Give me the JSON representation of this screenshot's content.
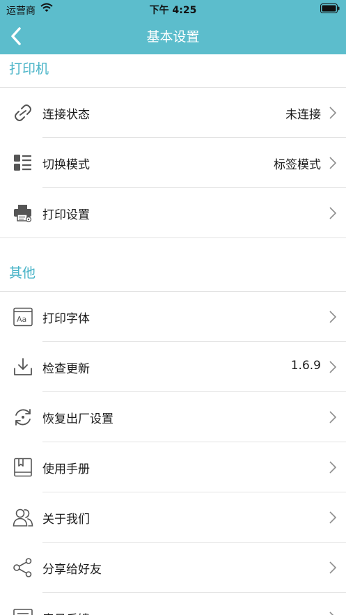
{
  "status_bar": {
    "carrier": "运营商",
    "time": "下午 4:25"
  },
  "nav": {
    "title": "基本设置",
    "back_icon": "chevron-left-icon"
  },
  "colors": {
    "header_bg": "#5cbdcc",
    "section_accent": "#47b3c7",
    "icon_stroke": "#555555",
    "chevron": "#8e8e8e"
  },
  "sections": {
    "printer": {
      "title": "打印机",
      "items": [
        {
          "label": "连接状态",
          "value": "未连接",
          "icon": "link-icon"
        },
        {
          "label": "切换模式",
          "value": "标签模式",
          "icon": "list-mode-icon"
        },
        {
          "label": "打印设置",
          "value": "",
          "icon": "printer-settings-icon"
        }
      ]
    },
    "other": {
      "title": "其他",
      "items": [
        {
          "label": "打印字体",
          "value": "",
          "icon": "font-icon"
        },
        {
          "label": "检查更新",
          "value": "1.6.9",
          "icon": "download-icon"
        },
        {
          "label": "恢复出厂设置",
          "value": "",
          "icon": "reset-icon"
        },
        {
          "label": "使用手册",
          "value": "",
          "icon": "manual-book-icon"
        },
        {
          "label": "关于我们",
          "value": "",
          "icon": "users-icon"
        },
        {
          "label": "分享给好友",
          "value": "",
          "icon": "share-icon"
        },
        {
          "label": "意见反馈",
          "value": "",
          "icon": "feedback-icon"
        }
      ]
    }
  }
}
